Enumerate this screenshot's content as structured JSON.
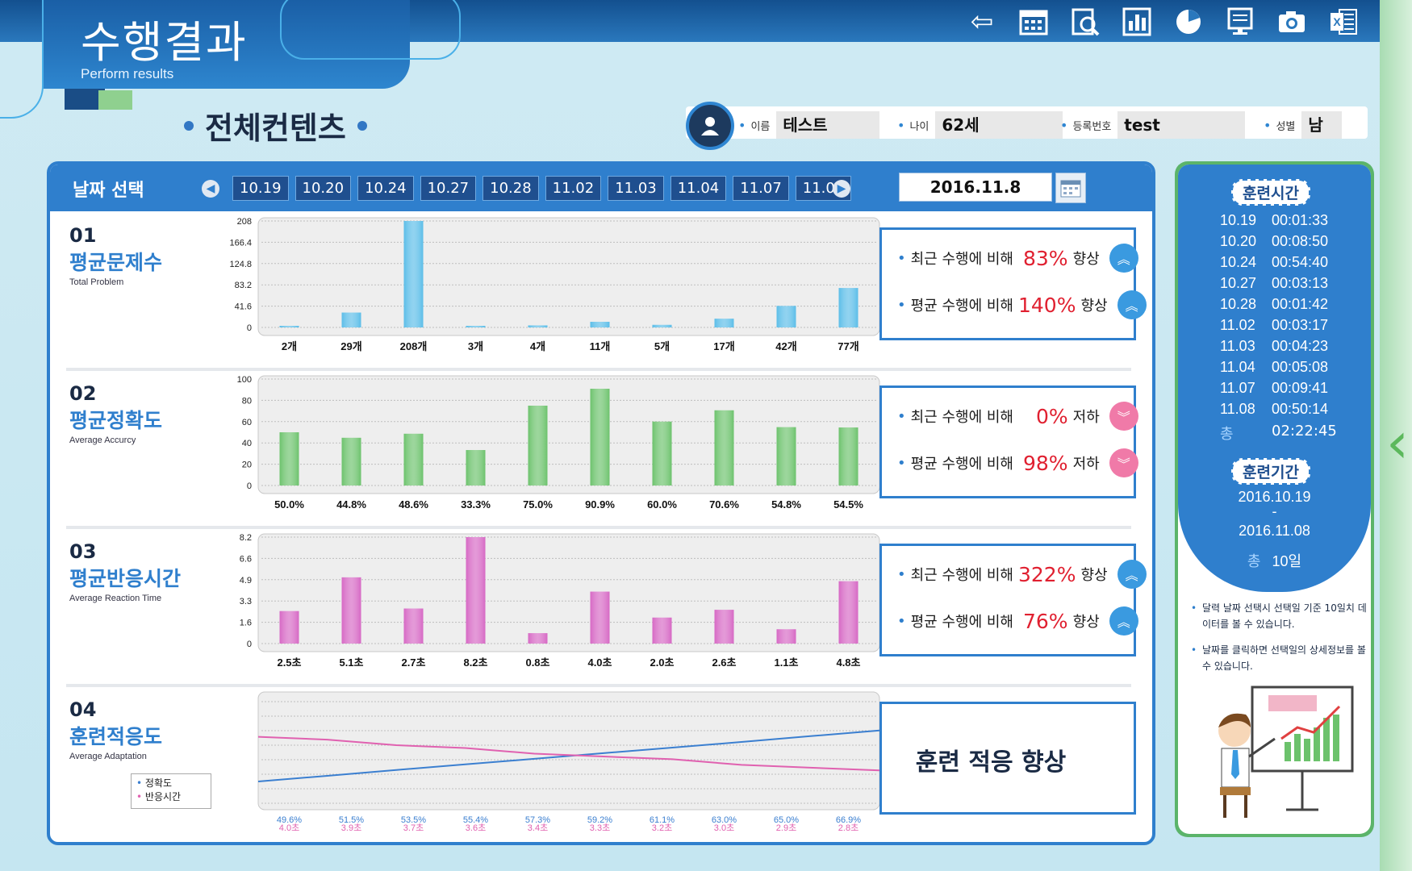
{
  "header": {
    "title": "수행결과",
    "subtitle": "Perform results",
    "tools": [
      "back-icon",
      "calendar-icon",
      "search-doc-icon",
      "bar-report-icon",
      "pie-chart-icon",
      "monitor-icon",
      "camera-icon",
      "excel-icon"
    ]
  },
  "section_title": "전체컨텐츠",
  "user": {
    "name_label": "이름",
    "name": "테스트",
    "age_label": "나이",
    "age": "62세",
    "id_label": "등록번호",
    "id": "test",
    "gender_label": "성별",
    "gender": "남"
  },
  "date_select": {
    "label": "날짜 선택",
    "dates": [
      "10.19",
      "10.20",
      "10.24",
      "10.27",
      "10.28",
      "11.02",
      "11.03",
      "11.04",
      "11.07",
      "11.08"
    ],
    "selected": "2016.11.8"
  },
  "rows": [
    {
      "num": "01",
      "name": "평균문제수",
      "en": "Total Problem",
      "recent": {
        "prefix": "최근 수행에 비해",
        "value": "83%",
        "status": "향상"
      },
      "average": {
        "prefix": "평균 수행에 비해",
        "value": "140%",
        "status": "향상"
      }
    },
    {
      "num": "02",
      "name": "평균정확도",
      "en": "Average Accurcy",
      "recent": {
        "prefix": "최근 수행에 비해",
        "value": "0%",
        "status": "저하"
      },
      "average": {
        "prefix": "평균 수행에 비해",
        "value": "98%",
        "status": "저하"
      }
    },
    {
      "num": "03",
      "name": "평균반응시간",
      "en": "Average Reaction Time",
      "recent": {
        "prefix": "최근 수행에 비해",
        "value": "322%",
        "status": "향상"
      },
      "average": {
        "prefix": "평균 수행에 비해",
        "value": "76%",
        "status": "향상"
      }
    },
    {
      "num": "04",
      "name": "훈련적응도",
      "en": "Average Adaptation",
      "message": "훈련 적응 향상",
      "legend": [
        "정확도",
        "반응시간"
      ]
    }
  ],
  "chart_data": [
    {
      "type": "bar",
      "categories": [
        "10.19",
        "10.20",
        "10.24",
        "10.27",
        "10.28",
        "11.02",
        "11.03",
        "11.04",
        "11.07",
        "11.08"
      ],
      "values": [
        2,
        29,
        208,
        3,
        4,
        11,
        5,
        17,
        42,
        77
      ],
      "labels": [
        "2개",
        "29개",
        "208개",
        "3개",
        "4개",
        "11개",
        "5개",
        "17개",
        "42개",
        "77개"
      ],
      "ylim": [
        0,
        208
      ],
      "yticks": [
        "0",
        "41.6",
        "83.2",
        "124.8",
        "166.4",
        "208"
      ],
      "color": "#5bbde8"
    },
    {
      "type": "bar",
      "categories": [
        "10.19",
        "10.20",
        "10.24",
        "10.27",
        "10.28",
        "11.02",
        "11.03",
        "11.04",
        "11.07",
        "11.08"
      ],
      "values": [
        50.0,
        44.8,
        48.6,
        33.3,
        75.0,
        90.9,
        60.0,
        70.6,
        54.8,
        54.5
      ],
      "labels": [
        "50.0%",
        "44.8%",
        "48.6%",
        "33.3%",
        "75.0%",
        "90.9%",
        "60.0%",
        "70.6%",
        "54.8%",
        "54.5%"
      ],
      "ylim": [
        0,
        100
      ],
      "yticks": [
        "0",
        "20",
        "40",
        "60",
        "80",
        "100"
      ],
      "color": "#6cc26c"
    },
    {
      "type": "bar",
      "categories": [
        "10.19",
        "10.20",
        "10.24",
        "10.27",
        "10.28",
        "11.02",
        "11.03",
        "11.04",
        "11.07",
        "11.08"
      ],
      "values": [
        2.5,
        5.1,
        2.7,
        8.2,
        0.8,
        4.0,
        2.0,
        2.6,
        1.1,
        4.8
      ],
      "labels": [
        "2.5초",
        "5.1초",
        "2.7초",
        "8.2초",
        "0.8초",
        "4.0초",
        "2.0초",
        "2.6초",
        "1.1초",
        "4.8초"
      ],
      "ylim": [
        0,
        8.2
      ],
      "yticks": [
        "0",
        "1.6",
        "3.3",
        "4.9",
        "6.6",
        "8.2"
      ],
      "color": "#d667c4"
    },
    {
      "type": "line",
      "series": [
        {
          "name": "정확도",
          "values": [
            49.6,
            51.5,
            53.5,
            55.4,
            57.3,
            59.2,
            61.1,
            63.0,
            65.0,
            66.9
          ],
          "labels": [
            "49.6%",
            "51.5%",
            "53.5%",
            "55.4%",
            "57.3%",
            "59.2%",
            "61.1%",
            "63.0%",
            "65.0%",
            "66.9%"
          ],
          "color": "#3b7fd0"
        },
        {
          "name": "반응시간",
          "values": [
            4.0,
            3.9,
            3.7,
            3.6,
            3.4,
            3.3,
            3.2,
            3.0,
            2.9,
            2.8
          ],
          "labels": [
            "4.0초",
            "3.9초",
            "3.7초",
            "3.6초",
            "3.4초",
            "3.3초",
            "3.2초",
            "3.0초",
            "2.9초",
            "2.8초"
          ],
          "color": "#e061b0"
        }
      ]
    }
  ],
  "side": {
    "train_time_label": "훈련시간",
    "times": [
      {
        "date": "10.19",
        "time": "00:01:33"
      },
      {
        "date": "10.20",
        "time": "00:08:50"
      },
      {
        "date": "10.24",
        "time": "00:54:40"
      },
      {
        "date": "10.27",
        "time": "00:03:13"
      },
      {
        "date": "10.28",
        "time": "00:01:42"
      },
      {
        "date": "11.02",
        "time": "00:03:17"
      },
      {
        "date": "11.03",
        "time": "00:04:23"
      },
      {
        "date": "11.04",
        "time": "00:05:08"
      },
      {
        "date": "11.07",
        "time": "00:09:41"
      },
      {
        "date": "11.08",
        "time": "00:50:14"
      }
    ],
    "total_label": "총",
    "total_time": "02:22:45",
    "period_label": "훈련기간",
    "period_start": "2016.10.19",
    "period_dash": "-",
    "period_end": "2016.11.08",
    "period_total_label": "총",
    "period_total": "10일",
    "note1": "달력 날짜 선택시 선택일 기준 10일치 데이터를 볼 수 있습니다.",
    "note2": "날짜를 클릭하면 선택일의 상세정보를 볼 수 있습니다."
  }
}
